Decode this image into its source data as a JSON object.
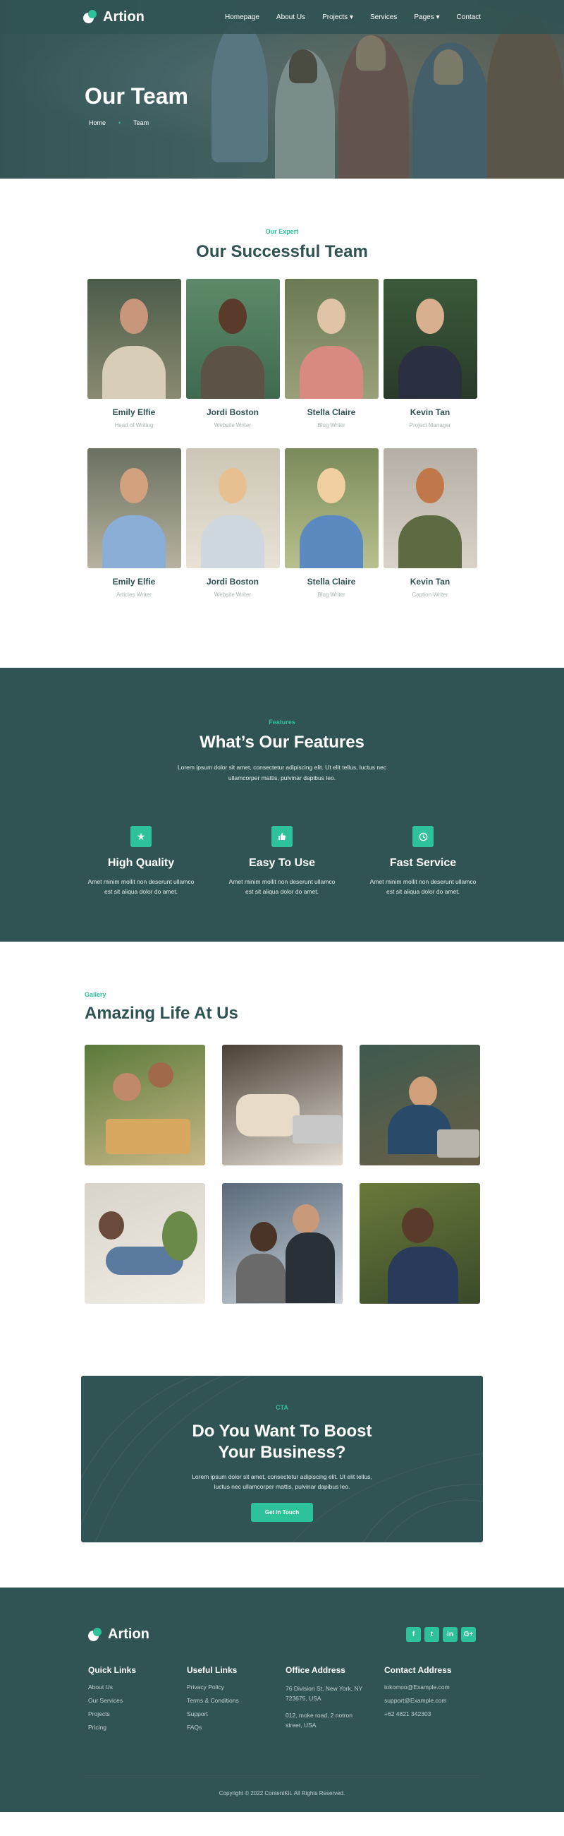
{
  "brand": {
    "name": "Artion",
    "accent": "#2dc29a",
    "primary": "#305353"
  },
  "nav": {
    "items": [
      {
        "label": "Homepage"
      },
      {
        "label": "About Us"
      },
      {
        "label": "Projects"
      },
      {
        "label": "Services"
      },
      {
        "label": "Pages"
      },
      {
        "label": "Contact"
      }
    ]
  },
  "hero": {
    "title": "Our Team",
    "breadcrumb": [
      "Home",
      "Team"
    ]
  },
  "team": {
    "eyebrow": "Our Expert",
    "title": "Our Successful Team",
    "members": [
      {
        "name": "Emily Elfie",
        "role": "Head of Writing"
      },
      {
        "name": "Jordi Boston",
        "role": "Website Writer"
      },
      {
        "name": "Stella Claire",
        "role": "Blog Writer"
      },
      {
        "name": "Kevin Tan",
        "role": "Project Manager"
      },
      {
        "name": "Emily Elfie",
        "role": "Articles Writer"
      },
      {
        "name": "Jordi Boston",
        "role": "Website Writer"
      },
      {
        "name": "Stella Claire",
        "role": "Blog Writer"
      },
      {
        "name": "Kevin Tan",
        "role": "Caption Writer"
      }
    ]
  },
  "features": {
    "eyebrow": "Features",
    "title": "What’s Our Features",
    "intro": "Lorem ipsum dolor sit amet, consectetur adipiscing elit. Ut elit tellus, luctus nec ullamcorper mattis, pulvinar dapibus leo.",
    "items": [
      {
        "icon": "star-icon",
        "title": "High Quality",
        "desc": "Amet minim mollit non deserunt ullamco est sit aliqua dolor do amet."
      },
      {
        "icon": "thumbs-up-icon",
        "title": "Easy To Use",
        "desc": "Amet minim mollit non deserunt ullamco est sit aliqua dolor do amet."
      },
      {
        "icon": "clock-icon",
        "title": "Fast Service",
        "desc": "Amet minim mollit non deserunt ullamco est sit aliqua dolor do amet."
      }
    ]
  },
  "gallery": {
    "eyebrow": "Gallery",
    "title": "Amazing Life At Us"
  },
  "cta": {
    "eyebrow": "CTA",
    "title_line1": "Do You Want To Boost",
    "title_line2": "Your Business?",
    "desc": "Lorem ipsum dolor sit amet, consectetur adipiscing elit. Ut elit tellus, luctus nec ullamcorper mattis, pulvinar dapibus leo.",
    "button": "Get In Touch"
  },
  "footer": {
    "socials": [
      "facebook-icon",
      "twitter-icon",
      "linkedin-icon",
      "google-plus-icon"
    ],
    "quick_links": {
      "title": "Quick Links",
      "items": [
        "About Us",
        "Our Services",
        "Projects",
        "Pricing"
      ]
    },
    "useful_links": {
      "title": "Useful Links",
      "items": [
        "Privacy Policy",
        "Terms & Conditions",
        "Support",
        "FAQs"
      ]
    },
    "office": {
      "title": "Office Address",
      "lines": [
        "76 Division St, New York, NY 723675, USA",
        "012, moke road, 2 notron street, USA"
      ]
    },
    "contact": {
      "title": "Contact Address",
      "items": [
        "tokomoo@Example.com",
        "support@Example.com",
        "+62 4821 342303"
      ]
    },
    "copyright": "Copyright © 2022 ContentKit. All Rights Reserved."
  }
}
